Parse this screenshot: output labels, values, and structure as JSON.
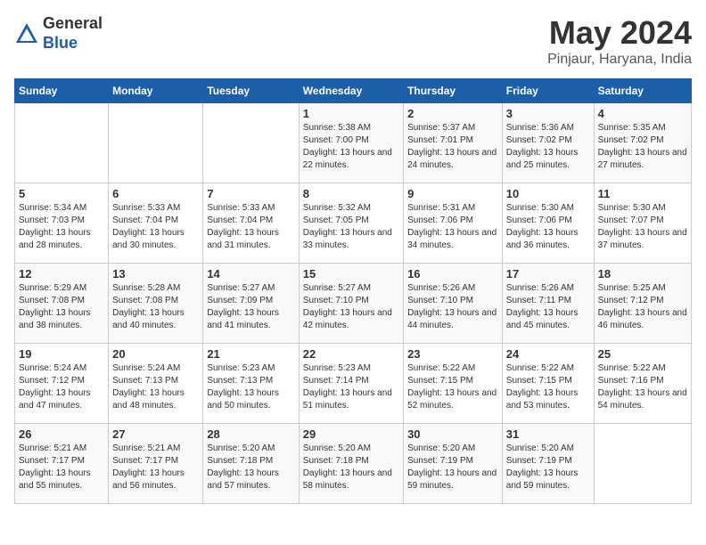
{
  "header": {
    "logo_line1": "General",
    "logo_line2": "Blue",
    "title": "May 2024",
    "subtitle": "Pinjaur, Haryana, India"
  },
  "days_of_week": [
    "Sunday",
    "Monday",
    "Tuesday",
    "Wednesday",
    "Thursday",
    "Friday",
    "Saturday"
  ],
  "weeks": [
    [
      {
        "day": "",
        "info": ""
      },
      {
        "day": "",
        "info": ""
      },
      {
        "day": "",
        "info": ""
      },
      {
        "day": "1",
        "info": "Sunrise: 5:38 AM\nSunset: 7:00 PM\nDaylight: 13 hours and 22 minutes."
      },
      {
        "day": "2",
        "info": "Sunrise: 5:37 AM\nSunset: 7:01 PM\nDaylight: 13 hours and 24 minutes."
      },
      {
        "day": "3",
        "info": "Sunrise: 5:36 AM\nSunset: 7:02 PM\nDaylight: 13 hours and 25 minutes."
      },
      {
        "day": "4",
        "info": "Sunrise: 5:35 AM\nSunset: 7:02 PM\nDaylight: 13 hours and 27 minutes."
      }
    ],
    [
      {
        "day": "5",
        "info": "Sunrise: 5:34 AM\nSunset: 7:03 PM\nDaylight: 13 hours and 28 minutes."
      },
      {
        "day": "6",
        "info": "Sunrise: 5:33 AM\nSunset: 7:04 PM\nDaylight: 13 hours and 30 minutes."
      },
      {
        "day": "7",
        "info": "Sunrise: 5:33 AM\nSunset: 7:04 PM\nDaylight: 13 hours and 31 minutes."
      },
      {
        "day": "8",
        "info": "Sunrise: 5:32 AM\nSunset: 7:05 PM\nDaylight: 13 hours and 33 minutes."
      },
      {
        "day": "9",
        "info": "Sunrise: 5:31 AM\nSunset: 7:06 PM\nDaylight: 13 hours and 34 minutes."
      },
      {
        "day": "10",
        "info": "Sunrise: 5:30 AM\nSunset: 7:06 PM\nDaylight: 13 hours and 36 minutes."
      },
      {
        "day": "11",
        "info": "Sunrise: 5:30 AM\nSunset: 7:07 PM\nDaylight: 13 hours and 37 minutes."
      }
    ],
    [
      {
        "day": "12",
        "info": "Sunrise: 5:29 AM\nSunset: 7:08 PM\nDaylight: 13 hours and 38 minutes."
      },
      {
        "day": "13",
        "info": "Sunrise: 5:28 AM\nSunset: 7:08 PM\nDaylight: 13 hours and 40 minutes."
      },
      {
        "day": "14",
        "info": "Sunrise: 5:27 AM\nSunset: 7:09 PM\nDaylight: 13 hours and 41 minutes."
      },
      {
        "day": "15",
        "info": "Sunrise: 5:27 AM\nSunset: 7:10 PM\nDaylight: 13 hours and 42 minutes."
      },
      {
        "day": "16",
        "info": "Sunrise: 5:26 AM\nSunset: 7:10 PM\nDaylight: 13 hours and 44 minutes."
      },
      {
        "day": "17",
        "info": "Sunrise: 5:26 AM\nSunset: 7:11 PM\nDaylight: 13 hours and 45 minutes."
      },
      {
        "day": "18",
        "info": "Sunrise: 5:25 AM\nSunset: 7:12 PM\nDaylight: 13 hours and 46 minutes."
      }
    ],
    [
      {
        "day": "19",
        "info": "Sunrise: 5:24 AM\nSunset: 7:12 PM\nDaylight: 13 hours and 47 minutes."
      },
      {
        "day": "20",
        "info": "Sunrise: 5:24 AM\nSunset: 7:13 PM\nDaylight: 13 hours and 48 minutes."
      },
      {
        "day": "21",
        "info": "Sunrise: 5:23 AM\nSunset: 7:13 PM\nDaylight: 13 hours and 50 minutes."
      },
      {
        "day": "22",
        "info": "Sunrise: 5:23 AM\nSunset: 7:14 PM\nDaylight: 13 hours and 51 minutes."
      },
      {
        "day": "23",
        "info": "Sunrise: 5:22 AM\nSunset: 7:15 PM\nDaylight: 13 hours and 52 minutes."
      },
      {
        "day": "24",
        "info": "Sunrise: 5:22 AM\nSunset: 7:15 PM\nDaylight: 13 hours and 53 minutes."
      },
      {
        "day": "25",
        "info": "Sunrise: 5:22 AM\nSunset: 7:16 PM\nDaylight: 13 hours and 54 minutes."
      }
    ],
    [
      {
        "day": "26",
        "info": "Sunrise: 5:21 AM\nSunset: 7:17 PM\nDaylight: 13 hours and 55 minutes."
      },
      {
        "day": "27",
        "info": "Sunrise: 5:21 AM\nSunset: 7:17 PM\nDaylight: 13 hours and 56 minutes."
      },
      {
        "day": "28",
        "info": "Sunrise: 5:20 AM\nSunset: 7:18 PM\nDaylight: 13 hours and 57 minutes."
      },
      {
        "day": "29",
        "info": "Sunrise: 5:20 AM\nSunset: 7:18 PM\nDaylight: 13 hours and 58 minutes."
      },
      {
        "day": "30",
        "info": "Sunrise: 5:20 AM\nSunset: 7:19 PM\nDaylight: 13 hours and 59 minutes."
      },
      {
        "day": "31",
        "info": "Sunrise: 5:20 AM\nSunset: 7:19 PM\nDaylight: 13 hours and 59 minutes."
      },
      {
        "day": "",
        "info": ""
      }
    ]
  ]
}
